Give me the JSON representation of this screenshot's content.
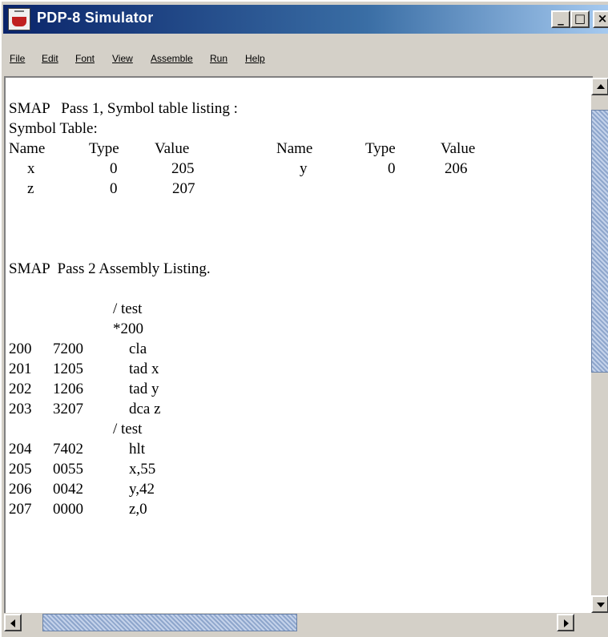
{
  "window": {
    "title": "PDP-8 Simulator",
    "minimize_glyph": "_",
    "maximize_glyph": "□",
    "close_glyph": "×"
  },
  "menu": [
    {
      "label": "File"
    },
    {
      "label": "Edit"
    },
    {
      "label": "Font"
    },
    {
      "label": "View"
    },
    {
      "label": "Assemble"
    },
    {
      "label": "Run"
    },
    {
      "label": "Help"
    }
  ],
  "listing": {
    "pass1_header": "SMAP   Pass 1, Symbol table listing :",
    "symbol_table_label": "Symbol Table:",
    "symbol_columns": [
      "Name",
      "Type",
      "Value",
      "Name",
      "Type",
      "Value"
    ],
    "symbols": [
      {
        "name": "x",
        "type": "0",
        "value": "205"
      },
      {
        "name": "y",
        "type": "0",
        "value": "206"
      },
      {
        "name": "z",
        "type": "0",
        "value": "207"
      }
    ],
    "pass2_header": "SMAP  Pass 2 Assembly Listing.",
    "lines": [
      {
        "addr": "",
        "code": "",
        "src": "/ test"
      },
      {
        "addr": "",
        "code": "",
        "src": "*200"
      },
      {
        "addr": "200",
        "code": "7200",
        "src": "cla"
      },
      {
        "addr": "201",
        "code": "1205",
        "src": "tad x"
      },
      {
        "addr": "202",
        "code": "1206",
        "src": "tad y"
      },
      {
        "addr": "203",
        "code": "3207",
        "src": "dca z"
      },
      {
        "addr": "",
        "code": "",
        "src": "/ test"
      },
      {
        "addr": "204",
        "code": "7402",
        "src": "hlt"
      },
      {
        "addr": "205",
        "code": "0055",
        "src": "x,55"
      },
      {
        "addr": "206",
        "code": "0042",
        "src": "y,42"
      },
      {
        "addr": "207",
        "code": "0000",
        "src": "z,0"
      }
    ]
  },
  "colors": {
    "titlebar_start": "#0a246a",
    "titlebar_end": "#a6caf0",
    "scroll_thumb": "#a6b8d6",
    "chrome": "#d4d0c8"
  }
}
